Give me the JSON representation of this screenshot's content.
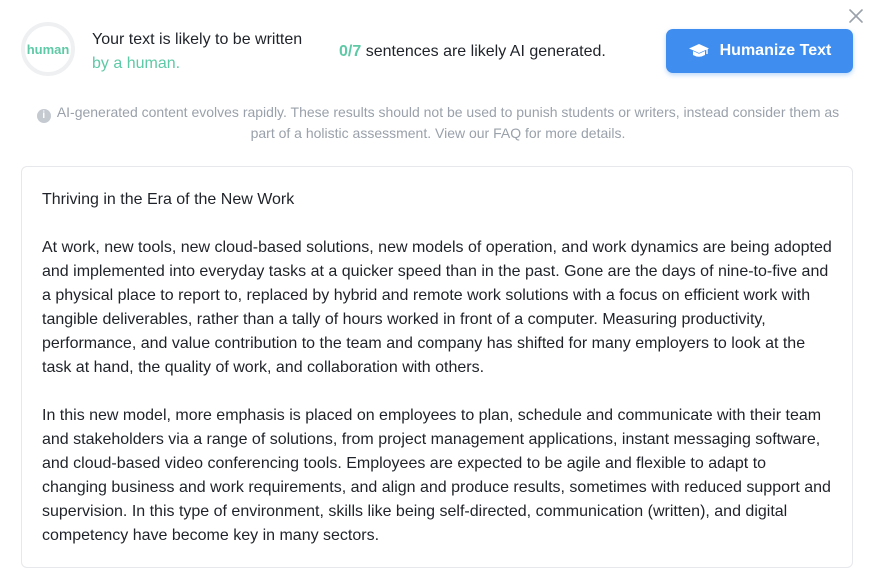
{
  "result": {
    "ring_label": "human",
    "verdict_prefix": "Your text is likely to be written ",
    "verdict_accent": "by a human.",
    "sentence_count": "0/7",
    "sentence_suffix": " sentences are likely ",
    "sentence_emphasis": "AI generated."
  },
  "actions": {
    "humanize_label": "Humanize Text",
    "humanize_icon": "graduation-cap-icon",
    "close_icon": "close-icon"
  },
  "disclaimer": {
    "text": "AI-generated content evolves rapidly. These results should not be used to punish students or writers, instead consider them as part of a holistic assessment. View our FAQ for more details."
  },
  "document": {
    "title": "Thriving in the Era of the New Work",
    "paragraphs": [
      "At work, new tools, new cloud-based solutions, new models of operation, and work dynamics are being adopted and implemented into everyday tasks at a quicker speed than in the past. Gone are the days of nine-to-five and a physical place to report to, replaced by hybrid and remote work solutions with a focus on efficient work with tangible deliverables, rather than a tally of hours worked in front of a computer. Measuring productivity, performance, and value contribution to the team and company has shifted for many employers to look at the task at hand, the quality of work, and collaboration with others.",
      "In this new model, more emphasis is placed on employees to plan, schedule and communicate with their team and stakeholders via a range of solutions, from project management applications, instant messaging software, and cloud-based video conferencing tools. Employees are expected to be agile and flexible to adapt to changing business and work requirements, and align and produce results, sometimes with reduced support and supervision. In this type of environment, skills like being self-directed, communication (written), and digital competency have become key in many sectors."
    ]
  },
  "colors": {
    "accent_green": "#5ec9a6",
    "button_blue": "#3f8dee",
    "text": "#1f2329",
    "muted": "#9aa1aa"
  }
}
